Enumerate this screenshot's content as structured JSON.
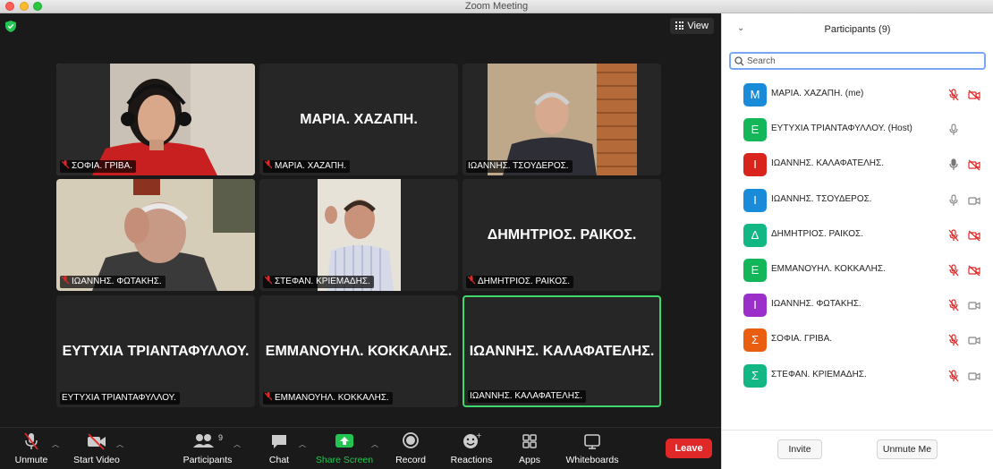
{
  "window": {
    "title": "Zoom Meeting"
  },
  "view_button": {
    "label": "View"
  },
  "tiles": [
    {
      "name": "ΣΟΦΙΑ. ΓΡΙΒΑ.",
      "center": "",
      "muted": true,
      "video": true
    },
    {
      "name": "ΜΑΡΙΑ. ΧΑΖΑΠΗ.",
      "center": "ΜΑΡΙΑ. ΧΑΖΑΠΗ.",
      "muted": true,
      "video": false
    },
    {
      "name": "ΙΩΑΝΝΗΣ. ΤΣΟΥΔΕΡΟΣ.",
      "center": "",
      "muted": false,
      "video": true
    },
    {
      "name": "ΙΩΑΝΝΗΣ. ΦΩΤΑΚΗΣ.",
      "center": "",
      "muted": true,
      "video": true
    },
    {
      "name": "ΣΤΕΦΑΝ. ΚΡΙΕΜΑΔΗΣ.",
      "center": "",
      "muted": true,
      "video": true
    },
    {
      "name": "ΔΗΜΗΤΡΙΟΣ. ΡΑΙΚΟΣ.",
      "center": "ΔΗΜΗΤΡΙΟΣ. ΡΑΙΚΟΣ.",
      "muted": true,
      "video": false
    },
    {
      "name": "ΕΥΤΥΧΙΑ ΤΡΙΑΝΤΑΦΥΛΛΟΥ.",
      "center": "ΕΥΤΥΧΙΑ ΤΡΙΑΝΤΑΦΥΛΛΟΥ.",
      "muted": false,
      "video": false
    },
    {
      "name": "ΕΜΜΑΝΟΥΗΛ. ΚΟΚΚΑΛΗΣ.",
      "center": "ΕΜΜΑΝΟΥΗΛ. ΚΟΚΚΑΛΗΣ.",
      "muted": true,
      "video": false
    },
    {
      "name": "ΙΩΑΝΝΗΣ. ΚΑΛΑΦΑΤΕΛΗΣ.",
      "center": "ΙΩΑΝΝΗΣ. ΚΑΛΑΦΑΤΕΛΗΣ.",
      "muted": false,
      "video": false,
      "active_speaker": true
    }
  ],
  "toolbar": {
    "unmute": "Unmute",
    "start_video": "Start Video",
    "participants": "Participants",
    "participants_count": "9",
    "chat": "Chat",
    "share_screen": "Share Screen",
    "record": "Record",
    "reactions": "Reactions",
    "apps": "Apps",
    "whiteboards": "Whiteboards",
    "leave": "Leave"
  },
  "panel": {
    "title": "Participants (9)",
    "search_placeholder": "Search",
    "participants": [
      {
        "initial": "M",
        "name": "ΜΑΡΙΑ. ΧΑΖΑΠΗ. (me)",
        "color": "#1a8bd8",
        "mic": "muted",
        "cam": "off"
      },
      {
        "initial": "Ε",
        "name": "ΕΥΤΥΧΙΑ ΤΡΙΑΝΤΑΦΥΛΛΟΥ. (Host)",
        "color": "#13b75a",
        "mic": "on",
        "cam": "none"
      },
      {
        "initial": "Ι",
        "name": "ΙΩΑΝΝΗΣ. ΚΑΛΑΦΑΤΕΛΗΣ.",
        "color": "#d9241c",
        "mic": "speaking",
        "cam": "off"
      },
      {
        "initial": "Ι",
        "name": "ΙΩΑΝΝΗΣ. ΤΣΟΥΔΕΡΟΣ.",
        "color": "#1a8bd8",
        "mic": "on",
        "cam": "on"
      },
      {
        "initial": "Δ",
        "name": "ΔΗΜΗΤΡΙΟΣ. ΡΑΙΚΟΣ.",
        "color": "#13b784",
        "mic": "muted",
        "cam": "off"
      },
      {
        "initial": "Ε",
        "name": "ΕΜΜΑΝΟΥΗΛ. ΚΟΚΚΑΛΗΣ.",
        "color": "#13b75a",
        "mic": "muted",
        "cam": "off"
      },
      {
        "initial": "Ι",
        "name": "ΙΩΑΝΝΗΣ. ΦΩΤΑΚΗΣ.",
        "color": "#9b2fc9",
        "mic": "muted",
        "cam": "on"
      },
      {
        "initial": "Σ",
        "name": "ΣΟΦΙΑ. ΓΡΙΒΑ.",
        "color": "#ea5e12",
        "mic": "muted",
        "cam": "on"
      },
      {
        "initial": "Σ",
        "name": "ΣΤΕΦΑΝ. ΚΡΙΕΜΑΔΗΣ.",
        "color": "#13b784",
        "mic": "muted",
        "cam": "on"
      }
    ],
    "invite": "Invite",
    "unmute_me": "Unmute Me"
  }
}
